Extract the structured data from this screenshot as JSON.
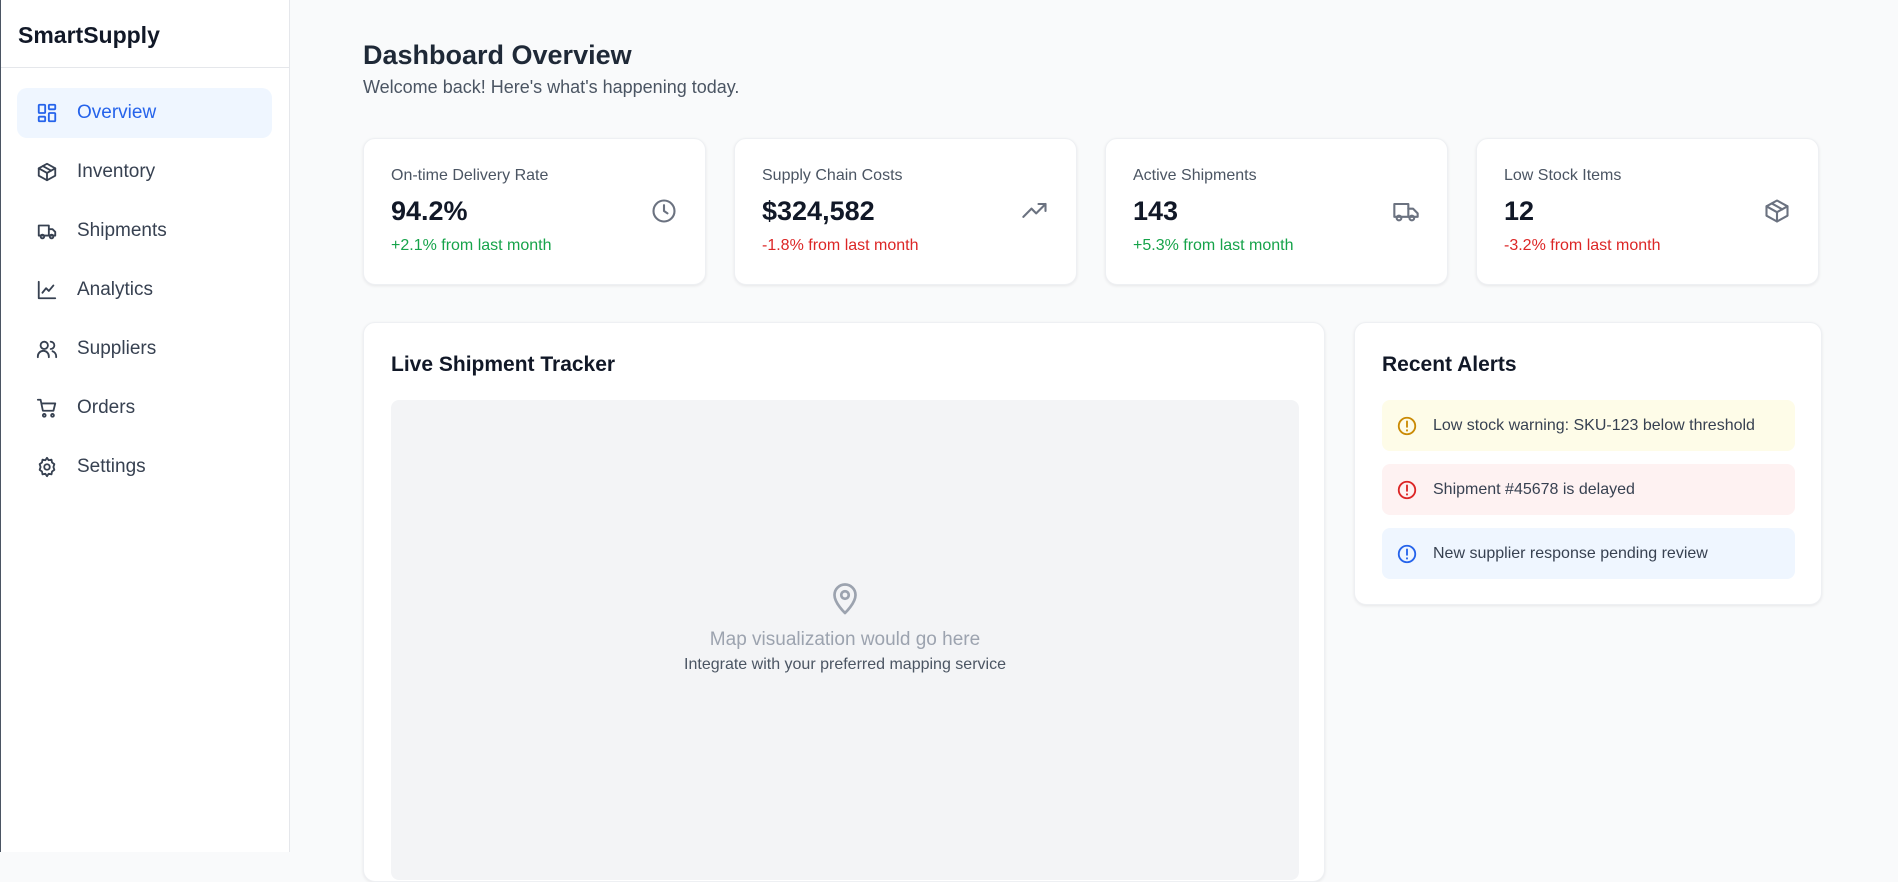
{
  "app": {
    "name": "SmartSupply"
  },
  "sidebar": {
    "items": [
      {
        "label": "Overview",
        "icon": "layout-dashboard-icon",
        "active": true
      },
      {
        "label": "Inventory",
        "icon": "package-icon"
      },
      {
        "label": "Shipments",
        "icon": "truck-icon"
      },
      {
        "label": "Analytics",
        "icon": "line-chart-icon"
      },
      {
        "label": "Suppliers",
        "icon": "users-icon"
      },
      {
        "label": "Orders",
        "icon": "shopping-cart-icon"
      },
      {
        "label": "Settings",
        "icon": "gear-icon"
      }
    ]
  },
  "header": {
    "title": "Dashboard Overview",
    "subtitle": "Welcome back! Here's what's happening today."
  },
  "stats": [
    {
      "label": "On-time Delivery Rate",
      "value": "94.2%",
      "change": "+2.1% from last month",
      "trend": "up",
      "icon": "clock-icon"
    },
    {
      "label": "Supply Chain Costs",
      "value": "$324,582",
      "change": "-1.8% from last month",
      "trend": "down",
      "icon": "trending-up-icon"
    },
    {
      "label": "Active Shipments",
      "value": "143",
      "change": "+5.3% from last month",
      "trend": "up",
      "icon": "truck-icon"
    },
    {
      "label": "Low Stock Items",
      "value": "12",
      "change": "-3.2% from last month",
      "trend": "down",
      "icon": "package-icon"
    }
  ],
  "tracker": {
    "title": "Live Shipment Tracker",
    "placeholder": "Map visualization would go here",
    "placeholder_sub": "Integrate with your preferred mapping service"
  },
  "alerts": {
    "title": "Recent Alerts",
    "items": [
      {
        "text": "Low stock warning: SKU-123 below threshold",
        "level": "warning"
      },
      {
        "text": "Shipment #45678 is delayed",
        "level": "error"
      },
      {
        "text": "New supplier response pending review",
        "level": "info"
      }
    ]
  },
  "colors": {
    "accent": "#2563eb",
    "positive": "#16a34a",
    "negative": "#dc2626",
    "warning": "#ca8a04"
  }
}
